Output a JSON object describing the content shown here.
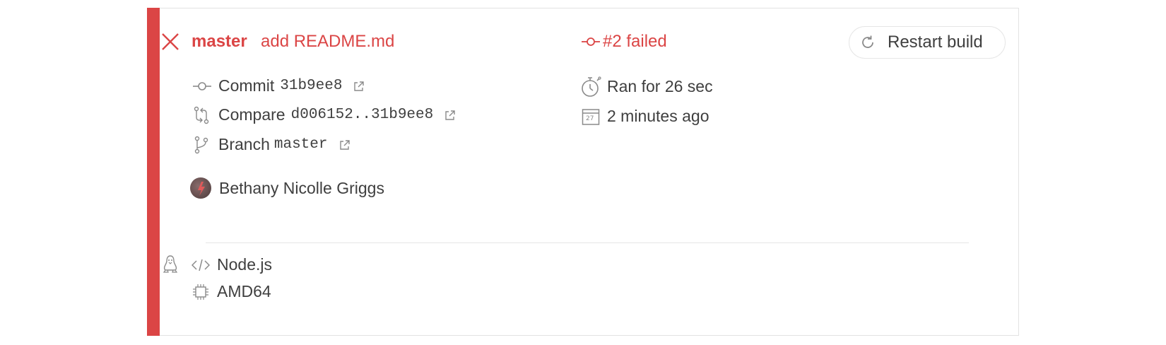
{
  "build": {
    "branch": "master",
    "message": "add README.md",
    "status": "#2 failed",
    "restart_label": "Restart build",
    "commit_label": "Commit",
    "commit_sha": "31b9ee8",
    "compare_label": "Compare",
    "compare_range": "d006152..31b9ee8",
    "branch_label": "Branch",
    "branch_name": "master",
    "duration": "Ran for 26 sec",
    "when": "2 minutes ago",
    "author": "Bethany Nicolle Griggs",
    "calendar_day": "27",
    "language": "Node.js",
    "arch": "AMD64"
  },
  "colors": {
    "failed": "#db4545",
    "text": "#3f3f3f",
    "icon": "#8a8a8a",
    "border": "#e3e3e3"
  },
  "icons": [
    "x-icon",
    "commit-icon",
    "compare-icon",
    "branch-icon",
    "external-link-icon",
    "stopwatch-icon",
    "calendar-icon",
    "restart-icon",
    "linux-icon",
    "code-icon",
    "cpu-icon"
  ]
}
